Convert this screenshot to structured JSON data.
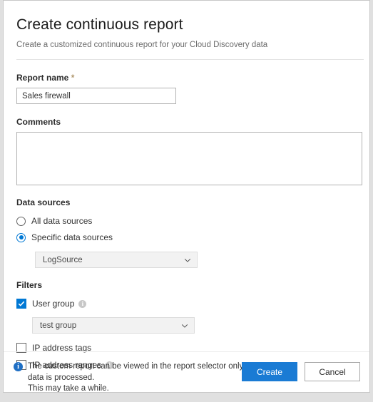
{
  "dialog": {
    "title": "Create continuous report",
    "subtitle": "Create a customized continuous report for your Cloud Discovery data"
  },
  "report_name": {
    "label": "Report name",
    "required_marker": "*",
    "value": "Sales firewall",
    "placeholder": ""
  },
  "comments": {
    "label": "Comments",
    "value": "",
    "placeholder": ""
  },
  "data_sources": {
    "label": "Data sources",
    "options": [
      {
        "label": "All data sources",
        "selected": false
      },
      {
        "label": "Specific data sources",
        "selected": true
      }
    ],
    "dropdown": {
      "value": "LogSource",
      "icon": "chevron-down-icon"
    }
  },
  "filters": {
    "label": "Filters",
    "user_group": {
      "label": "User group",
      "checked": true,
      "info_icon": "info-circle-icon",
      "dropdown": {
        "value": "test group",
        "icon": "chevron-down-icon"
      }
    },
    "ip_address_tags": {
      "label": "IP address tags",
      "checked": false
    },
    "ip_address_ranges": {
      "label": "IP address ranges",
      "checked": false,
      "info_icon": "info-circle-icon"
    }
  },
  "footer": {
    "info_icon": "info-circle-filled-icon",
    "note_line1": "The custom report can be viewed in the report selector only after the new",
    "note_line2": "data is processed.",
    "note_line3": "This may take a while.",
    "create_label": "Create",
    "cancel_label": "Cancel"
  },
  "colors": {
    "accent": "#0078d4",
    "primary_button": "#1a7bd4",
    "info_blue": "#1f6fc4",
    "info_gray": "#c7c7c7",
    "required_star": "#b0976d"
  }
}
